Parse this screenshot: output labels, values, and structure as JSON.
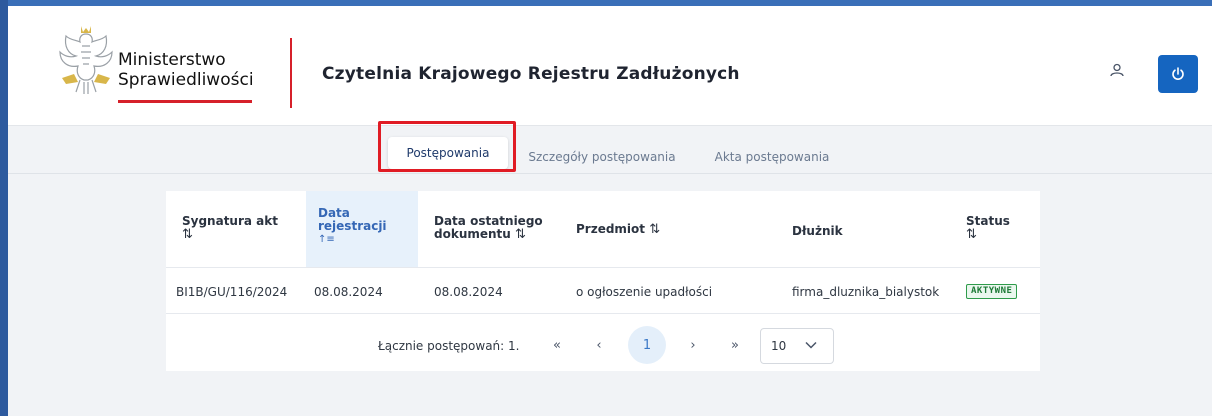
{
  "header": {
    "ministry_line1": "Ministerstwo",
    "ministry_line2": "Sprawiedliwości",
    "app_title": "Czytelnia Krajowego Rejestru Zadłużonych",
    "user_icon": "user-icon",
    "power_icon": "power-icon"
  },
  "tabs": [
    {
      "label": "Postępowania",
      "active": true
    },
    {
      "label": "Szczegóły postępowania",
      "active": false
    },
    {
      "label": "Akta postępowania",
      "active": false
    }
  ],
  "table": {
    "columns": [
      {
        "line1": "Sygnatura akt",
        "line2": "",
        "sort": "⇅"
      },
      {
        "line1": "Data",
        "line2": "rejestracji",
        "sort": "↑≡"
      },
      {
        "line1": "Data ostatniego",
        "line2": "dokumentu",
        "sort": "⇅"
      },
      {
        "line1": "Przedmiot",
        "line2": "",
        "sort": "⇅"
      },
      {
        "line1": "Dłużnik",
        "line2": "",
        "sort": ""
      },
      {
        "line1": "Status",
        "line2": "",
        "sort": "⇅"
      }
    ],
    "rows": [
      {
        "sygnatura": "BI1B/GU/116/2024",
        "data_rejestracji": "08.08.2024",
        "data_ostatniego": "08.08.2024",
        "przedmiot": "o ogłoszenie upadłości",
        "dluznik": "firma_dluznika_bialystok",
        "status": "AKTYWNE"
      }
    ]
  },
  "pagination": {
    "total_label": "Łącznie postępowań: 1.",
    "first": "«",
    "prev": "‹",
    "current": "1",
    "next": "›",
    "last": "»",
    "page_size": "10"
  },
  "colors": {
    "accent_blue": "#1565c0",
    "highlight_red": "#e01b24",
    "status_green": "#2e9b4a"
  }
}
